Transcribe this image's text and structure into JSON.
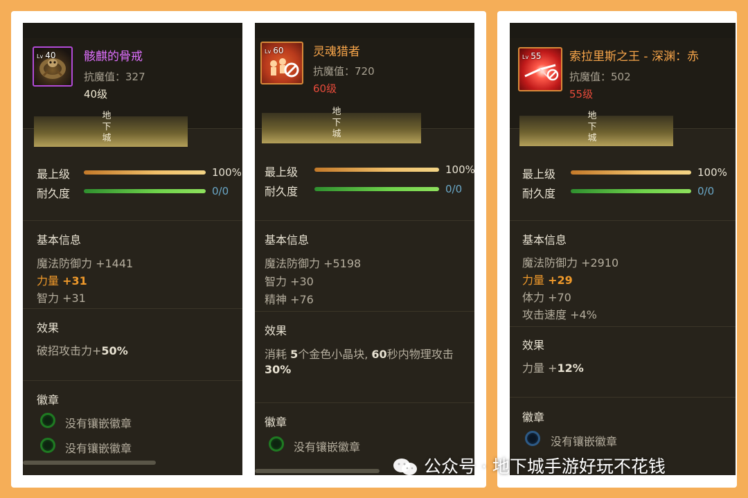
{
  "colors": {
    "background": "#f5ae58",
    "panel": "#27231b",
    "orange_text": "#f09a2b",
    "level_red": "#e84b3b",
    "name_purple": "#e070ff",
    "name_orange": "#f7a54a"
  },
  "common": {
    "tab_label": "地下城",
    "max_level_label": "最上级",
    "max_level_value": "100%",
    "max_level_progress": 1.0,
    "durability_label": "耐久度",
    "durability_value": "0/0",
    "durability_progress": 1.0,
    "basic_info": "基本信息",
    "effect": "效果",
    "emblem": "徽章",
    "no_emblem": "没有镶嵌徽章"
  },
  "panels": [
    {
      "level_badge": "40",
      "lv_prefix": "Lv",
      "icon": "skull-ring-icon",
      "name": "骸麒的骨戒",
      "resist": "抗魔值：327",
      "level_text": "40级",
      "stats": [
        {
          "text": "魔法防御力 +1441"
        },
        {
          "label": "力量 ",
          "value": "+31"
        },
        {
          "text": "智力 +31"
        }
      ],
      "effect_prefix": "破招攻击力+",
      "effect_value": "50%"
    },
    {
      "level_badge": "60",
      "lv_prefix": "Lv",
      "icon": "soul-hunter-icon",
      "name": "灵魂猎者",
      "resist": "抗魔值：720",
      "level_text": "60级",
      "stats": [
        {
          "text": "魔法防御力 +5198"
        },
        {
          "text": "智力 +30"
        },
        {
          "text": "精神 +76"
        }
      ],
      "effect_line1_a": "消耗 ",
      "effect_line1_b": "5",
      "effect_line1_c": "个金色小晶块, ",
      "effect_line1_d": "60",
      "effect_line1_e": "秒内物理攻击",
      "effect_line2": "30%"
    },
    {
      "level_badge": "55",
      "lv_prefix": "Lv",
      "icon": "solaris-king-icon",
      "name": "索拉里斯之王 - 深渊：赤",
      "resist": "抗魔值：502",
      "level_text": "55级",
      "stats": [
        {
          "text": "魔法防御力 +2910"
        },
        {
          "label": "力量 ",
          "value": "+29"
        },
        {
          "text": "体力 +70"
        },
        {
          "text": "攻击速度 +4%"
        }
      ],
      "effect_prefix": "力量 +",
      "effect_value": "12%"
    }
  ],
  "watermark": {
    "icon": "wechat-icon",
    "text": "公众号 · 地下城手游好玩不花钱"
  }
}
